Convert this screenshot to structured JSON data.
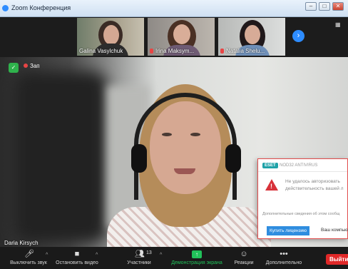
{
  "window": {
    "title": "Zoom Конференция",
    "minimize": "–",
    "maximize": "□",
    "close": "✕"
  },
  "participants_strip": [
    {
      "name": "Galina Vasylchuk"
    },
    {
      "name": "Irina Maksym..."
    },
    {
      "name": "Natalia Shelu..."
    }
  ],
  "strip_controls": {
    "next_icon": "chevron-right-icon",
    "next_glyph": "›"
  },
  "main_video": {
    "speaker_name": "Daria Kirsych",
    "recording_label": "Зап"
  },
  "popup": {
    "brand": "ESET",
    "header": "NOD32 ANTIVIRUS",
    "message_line1": "Не удалось авторизовать",
    "message_line2": "действительность вашей л",
    "extra": "Дополнительные сведения об этом сообщ",
    "buy_button": "Купить лицензию",
    "company_link": "Ваш компью"
  },
  "toolbar": {
    "mute": "Выключить звук",
    "stop_video": "Остановить видео",
    "participants": "Участники",
    "participants_count": "13",
    "share": "Демонстрация экрана",
    "reactions": "Реакции",
    "more": "Дополнительно",
    "end": "Выйти"
  },
  "colors": {
    "accent": "#2d8cff",
    "share": "#21c25a",
    "end": "#e02828",
    "alert": "#d8323a"
  }
}
